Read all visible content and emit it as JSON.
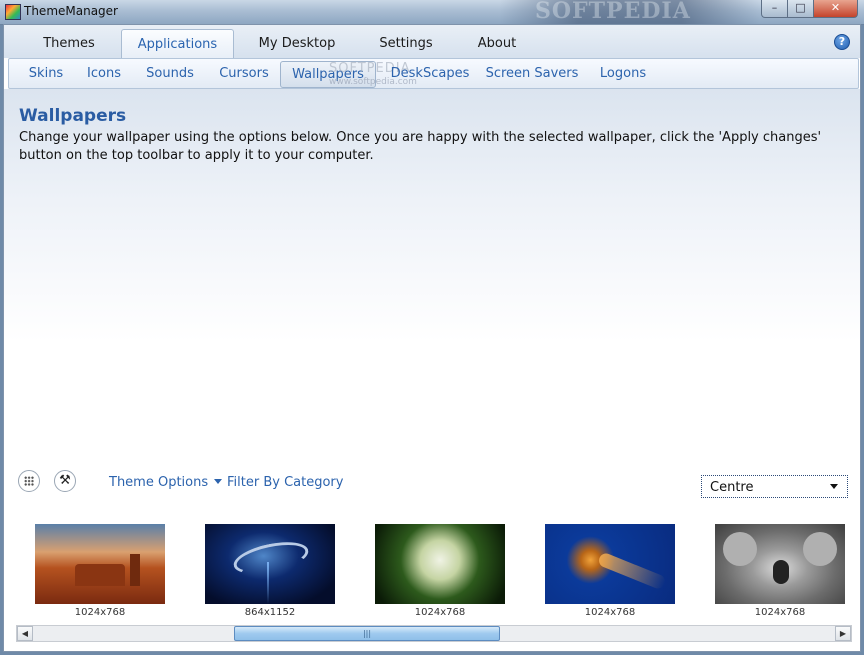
{
  "window": {
    "title": "ThemeManager",
    "watermark": "SOFTPEDIA"
  },
  "window_buttons": {
    "minimize": "–",
    "maximize": "□",
    "close": "✕"
  },
  "main_tabs": [
    {
      "label": "Themes",
      "active": false
    },
    {
      "label": "Applications",
      "active": true
    },
    {
      "label": "My Desktop",
      "active": false
    },
    {
      "label": "Settings",
      "active": false
    },
    {
      "label": "About",
      "active": false
    }
  ],
  "help": {
    "glyph": "?",
    "icon": "help-icon"
  },
  "sub_tabs": [
    {
      "label": "Skins",
      "active": false
    },
    {
      "label": "Icons",
      "active": false
    },
    {
      "label": "Sounds",
      "active": false
    },
    {
      "label": "Cursors",
      "active": false
    },
    {
      "label": "Wallpapers",
      "active": true
    },
    {
      "label": "DeskScapes",
      "active": false
    },
    {
      "label": "Screen Savers",
      "active": false
    },
    {
      "label": "Logons",
      "active": false
    }
  ],
  "sub_watermark": {
    "text": "SOFTPEDIA",
    "url": "www.softpedia.com"
  },
  "page": {
    "title": "Wallpapers",
    "description": "Change your wallpaper using the options below. Once you are happy with the selected wallpaper, click the 'Apply changes' button on the top toolbar to apply it to your computer."
  },
  "toolbar": {
    "grid_icon": "grid-view-icon",
    "tools_icon": "tools-icon",
    "theme_options": "Theme Options",
    "filter": "Filter By Category",
    "position_select": "Centre"
  },
  "wallpapers": [
    {
      "resolution": "1024x768",
      "subject": "desert-mesa"
    },
    {
      "resolution": "864x1152",
      "subject": "abstract-blue-swirl"
    },
    {
      "resolution": "1024x768",
      "subject": "hydrangea"
    },
    {
      "resolution": "1024x768",
      "subject": "jellyfish"
    },
    {
      "resolution": "1024x768",
      "subject": "koala"
    }
  ],
  "scrollbar": {
    "left_arrow": "◀",
    "right_arrow": "▶",
    "grip": "|||"
  }
}
